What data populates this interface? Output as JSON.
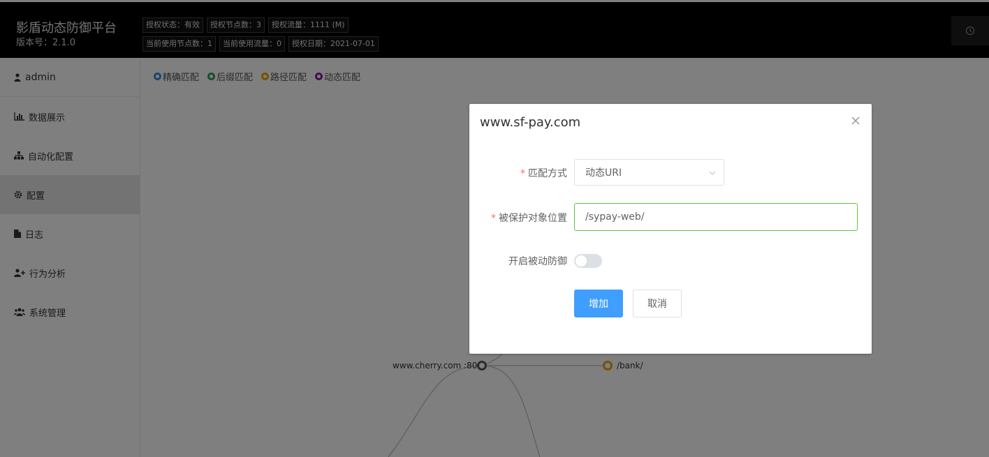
{
  "header": {
    "title": "影盾动态防御平台",
    "version": "版本号：2.1.0",
    "badges_row1": [
      "授权状态：有效",
      "授权节点数：3",
      "授权流量：1111 (M)"
    ],
    "badges_row2": [
      "当前使用节点数：1",
      "当前使用流量：0",
      "授权日期：2021-07-01"
    ],
    "clock_icon": "clock-icon"
  },
  "sidebar": {
    "user": "admin",
    "items": [
      {
        "label": "数据展示",
        "icon": "bar-chart-icon"
      },
      {
        "label": "自动化配置",
        "icon": "sitemap-icon"
      },
      {
        "label": "配置",
        "icon": "gear-icon",
        "active": true
      },
      {
        "label": "日志",
        "icon": "file-icon"
      },
      {
        "label": "行为分析",
        "icon": "user-plus-icon"
      },
      {
        "label": "系统管理",
        "icon": "users-icon"
      }
    ]
  },
  "legend": [
    {
      "label": "精确匹配",
      "color": "#3a8fd9"
    },
    {
      "label": "后缀匹配",
      "color": "#2e9e5e"
    },
    {
      "label": "路径匹配",
      "color": "#e6a700"
    },
    {
      "label": "动态匹配",
      "color": "#8a1f9e"
    }
  ],
  "graph": {
    "root_label": "www.cherry.com :80",
    "child_label": "/bank/"
  },
  "dialog": {
    "title": "www.sf-pay.com",
    "match_label": "匹配方式",
    "match_value": "动态URI",
    "location_label": "被保护对象位置",
    "location_value": "/sypay-web/",
    "passive_label": "开启被动防御",
    "passive_enabled": false,
    "add_label": "增加",
    "cancel_label": "取消"
  },
  "colors": {
    "primary": "#409eff",
    "valid_border": "#67c23a",
    "required": "#f56c6c"
  }
}
